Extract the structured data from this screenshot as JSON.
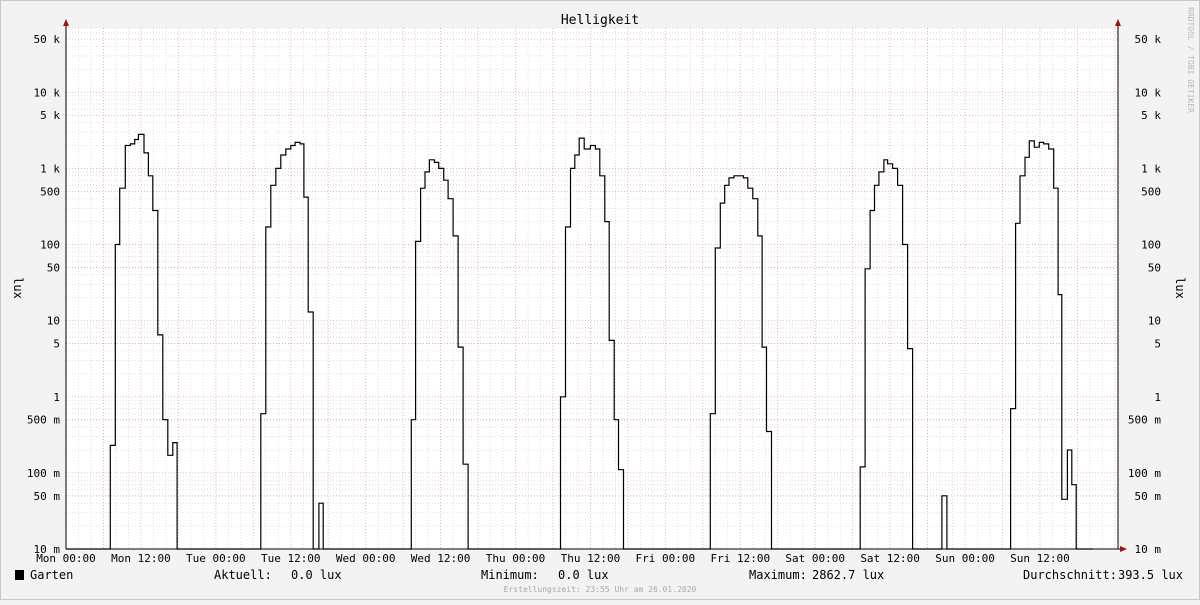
{
  "chart_data": {
    "type": "line",
    "title": "Helligkeit",
    "ylabel_left": "lux",
    "ylabel_right": "lux",
    "y_scale": "log",
    "ylim": [
      0.01,
      70000
    ],
    "y_ticks": [
      {
        "v": 0.01,
        "label": "10 m"
      },
      {
        "v": 0.05,
        "label": "50 m"
      },
      {
        "v": 0.1,
        "label": "100 m"
      },
      {
        "v": 0.5,
        "label": "500 m"
      },
      {
        "v": 1,
        "label": "1"
      },
      {
        "v": 5,
        "label": "5"
      },
      {
        "v": 10,
        "label": "10"
      },
      {
        "v": 50,
        "label": "50"
      },
      {
        "v": 100,
        "label": "100"
      },
      {
        "v": 500,
        "label": "500"
      },
      {
        "v": 1000,
        "label": "1 k"
      },
      {
        "v": 5000,
        "label": "5 k"
      },
      {
        "v": 10000,
        "label": "10 k"
      },
      {
        "v": 50000,
        "label": "50 k"
      }
    ],
    "x_unit": "hours since Mon 00:00",
    "xlim": [
      0,
      168.5
    ],
    "x_ticks": [
      {
        "h": 0,
        "label": "Mon 00:00"
      },
      {
        "h": 12,
        "label": "Mon 12:00"
      },
      {
        "h": 24,
        "label": "Tue 00:00"
      },
      {
        "h": 36,
        "label": "Tue 12:00"
      },
      {
        "h": 48,
        "label": "Wed 00:00"
      },
      {
        "h": 60,
        "label": "Wed 12:00"
      },
      {
        "h": 72,
        "label": "Thu 00:00"
      },
      {
        "h": 84,
        "label": "Thu 12:00"
      },
      {
        "h": 96,
        "label": "Fri 00:00"
      },
      {
        "h": 108,
        "label": "Fri 12:00"
      },
      {
        "h": 120,
        "label": "Sat 00:00"
      },
      {
        "h": 132,
        "label": "Sat 12:00"
      },
      {
        "h": 144,
        "label": "Sun 00:00"
      },
      {
        "h": 156,
        "label": "Sun 12:00"
      }
    ],
    "series": [
      {
        "name": "Garten",
        "color": "#000000",
        "step_points": [
          [
            0,
            0.01
          ],
          [
            7.1,
            0.01
          ],
          [
            7.1,
            0.23
          ],
          [
            7.9,
            0.23
          ],
          [
            7.9,
            100
          ],
          [
            8.6,
            100
          ],
          [
            8.6,
            550
          ],
          [
            9.5,
            550
          ],
          [
            9.5,
            2000
          ],
          [
            10.3,
            2000
          ],
          [
            10.3,
            2100
          ],
          [
            11,
            2100
          ],
          [
            11,
            2400
          ],
          [
            11.6,
            2400
          ],
          [
            11.6,
            2800
          ],
          [
            12.5,
            2800
          ],
          [
            12.5,
            1600
          ],
          [
            13.2,
            1600
          ],
          [
            13.2,
            800
          ],
          [
            13.9,
            800
          ],
          [
            13.9,
            280
          ],
          [
            14.7,
            280
          ],
          [
            14.7,
            6.5
          ],
          [
            15.5,
            6.5
          ],
          [
            15.5,
            0.5
          ],
          [
            16.3,
            0.5
          ],
          [
            16.3,
            0.17
          ],
          [
            17.1,
            0.17
          ],
          [
            17.1,
            0.25
          ],
          [
            17.8,
            0.25
          ],
          [
            17.8,
            0.01
          ],
          [
            31.2,
            0.01
          ],
          [
            31.2,
            0.6
          ],
          [
            32.0,
            0.6
          ],
          [
            32.0,
            170
          ],
          [
            32.8,
            170
          ],
          [
            32.8,
            600
          ],
          [
            33.6,
            600
          ],
          [
            33.6,
            1000
          ],
          [
            34.4,
            1000
          ],
          [
            34.4,
            1500
          ],
          [
            35.2,
            1500
          ],
          [
            35.2,
            1800
          ],
          [
            36.0,
            1800
          ],
          [
            36.0,
            2000
          ],
          [
            36.7,
            2000
          ],
          [
            36.7,
            2200
          ],
          [
            37.5,
            2200
          ],
          [
            37.5,
            2100
          ],
          [
            38.1,
            2100
          ],
          [
            38.1,
            420
          ],
          [
            38.8,
            420
          ],
          [
            38.8,
            13
          ],
          [
            39.6,
            13
          ],
          [
            39.6,
            0.01
          ],
          [
            40.5,
            0.01
          ],
          [
            40.5,
            0.04
          ],
          [
            41.2,
            0.04
          ],
          [
            41.2,
            0.01
          ],
          [
            55.3,
            0.01
          ],
          [
            55.3,
            0.5
          ],
          [
            56.0,
            0.5
          ],
          [
            56.0,
            110
          ],
          [
            56.8,
            110
          ],
          [
            56.8,
            550
          ],
          [
            57.5,
            550
          ],
          [
            57.5,
            900
          ],
          [
            58.2,
            900
          ],
          [
            58.2,
            1300
          ],
          [
            59.0,
            1300
          ],
          [
            59.0,
            1200
          ],
          [
            59.7,
            1200
          ],
          [
            59.7,
            1000
          ],
          [
            60.5,
            1000
          ],
          [
            60.5,
            700
          ],
          [
            61.2,
            700
          ],
          [
            61.2,
            400
          ],
          [
            62.0,
            400
          ],
          [
            62.0,
            130
          ],
          [
            62.8,
            130
          ],
          [
            62.8,
            4.5
          ],
          [
            63.6,
            4.5
          ],
          [
            63.6,
            0.13
          ],
          [
            64.4,
            0.13
          ],
          [
            64.4,
            0.01
          ],
          [
            79.2,
            0.01
          ],
          [
            79.2,
            1
          ],
          [
            80.0,
            1
          ],
          [
            80.0,
            170
          ],
          [
            80.8,
            170
          ],
          [
            80.8,
            1000
          ],
          [
            81.5,
            1000
          ],
          [
            81.5,
            1500
          ],
          [
            82.2,
            1500
          ],
          [
            82.2,
            2500
          ],
          [
            83.0,
            2500
          ],
          [
            83.0,
            1800
          ],
          [
            84.0,
            1800
          ],
          [
            84.0,
            2000
          ],
          [
            84.8,
            2000
          ],
          [
            84.8,
            1800
          ],
          [
            85.5,
            1800
          ],
          [
            85.5,
            800
          ],
          [
            86.3,
            800
          ],
          [
            86.3,
            200
          ],
          [
            87.0,
            200
          ],
          [
            87.0,
            5.5
          ],
          [
            87.8,
            5.5
          ],
          [
            87.8,
            0.5
          ],
          [
            88.5,
            0.5
          ],
          [
            88.5,
            0.11
          ],
          [
            89.3,
            0.11
          ],
          [
            89.3,
            0.01
          ],
          [
            103.2,
            0.01
          ],
          [
            103.2,
            0.6
          ],
          [
            104.0,
            0.6
          ],
          [
            104.0,
            90
          ],
          [
            104.8,
            90
          ],
          [
            104.8,
            350
          ],
          [
            105.5,
            350
          ],
          [
            105.5,
            600
          ],
          [
            106.2,
            600
          ],
          [
            106.2,
            750
          ],
          [
            107.0,
            750
          ],
          [
            107.0,
            800
          ],
          [
            108.5,
            800
          ],
          [
            108.5,
            750
          ],
          [
            109.2,
            750
          ],
          [
            109.2,
            550
          ],
          [
            110.0,
            550
          ],
          [
            110.0,
            400
          ],
          [
            110.8,
            400
          ],
          [
            110.8,
            130
          ],
          [
            111.5,
            130
          ],
          [
            111.5,
            4.5
          ],
          [
            112.2,
            4.5
          ],
          [
            112.2,
            0.35
          ],
          [
            113.0,
            0.35
          ],
          [
            113.0,
            0.01
          ],
          [
            127.2,
            0.01
          ],
          [
            127.2,
            0.12
          ],
          [
            128.0,
            0.12
          ],
          [
            128.0,
            48
          ],
          [
            128.8,
            48
          ],
          [
            128.8,
            280
          ],
          [
            129.5,
            280
          ],
          [
            129.5,
            600
          ],
          [
            130.2,
            600
          ],
          [
            130.2,
            900
          ],
          [
            131.0,
            900
          ],
          [
            131.0,
            1300
          ],
          [
            131.6,
            1300
          ],
          [
            131.6,
            1150
          ],
          [
            132.4,
            1150
          ],
          [
            132.4,
            1000
          ],
          [
            133.2,
            1000
          ],
          [
            133.2,
            600
          ],
          [
            134.0,
            600
          ],
          [
            134.0,
            100
          ],
          [
            134.8,
            100
          ],
          [
            134.8,
            4.3
          ],
          [
            135.6,
            4.3
          ],
          [
            135.6,
            0.01
          ],
          [
            140.3,
            0.01
          ],
          [
            140.3,
            0.05
          ],
          [
            141.1,
            0.05
          ],
          [
            141.1,
            0.01
          ],
          [
            151.3,
            0.01
          ],
          [
            151.3,
            0.7
          ],
          [
            152.1,
            0.7
          ],
          [
            152.1,
            190
          ],
          [
            152.8,
            190
          ],
          [
            152.8,
            800
          ],
          [
            153.6,
            800
          ],
          [
            153.6,
            1400
          ],
          [
            154.3,
            1400
          ],
          [
            154.3,
            2300
          ],
          [
            155.1,
            2300
          ],
          [
            155.1,
            1900
          ],
          [
            155.9,
            1900
          ],
          [
            155.9,
            2200
          ],
          [
            156.6,
            2200
          ],
          [
            156.6,
            2100
          ],
          [
            157.4,
            2100
          ],
          [
            157.4,
            1800
          ],
          [
            158.2,
            1800
          ],
          [
            158.2,
            550
          ],
          [
            158.9,
            550
          ],
          [
            158.9,
            22
          ],
          [
            159.5,
            22
          ],
          [
            159.5,
            0.045
          ],
          [
            160.4,
            0.045
          ],
          [
            160.4,
            0.2
          ],
          [
            161.1,
            0.2
          ],
          [
            161.1,
            0.07
          ],
          [
            161.8,
            0.07
          ],
          [
            161.8,
            0.01
          ],
          [
            164.5,
            0.01
          ]
        ]
      }
    ]
  },
  "legend": {
    "series_name": "Garten",
    "aktuell_label": "Aktuell:",
    "aktuell_value": "0.0 lux",
    "minimum_label": "Minimum:",
    "minimum_value": "0.0 lux",
    "maximum_label": "Maximum:",
    "maximum_value": "2862.7 lux",
    "durchschnitt_label": "Durchschnitt:",
    "durchschnitt_value": "393.5 lux"
  },
  "footer": "Erstellungszeit: 23:55 Uhr am 26.01.2020",
  "watermark": "RRDTOOL / TOBI OETIKER",
  "colors": {
    "background": "#f3f3f3",
    "canvas": "#ffffff",
    "grid_minor": "#d8d8d8",
    "grid_major": "#e8a0b0",
    "axis_arrow": "#a01010",
    "line": "#000000"
  }
}
